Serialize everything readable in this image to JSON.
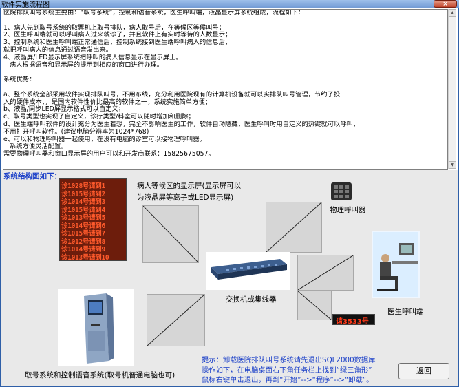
{
  "window": {
    "title": "软件实施流程图",
    "close_glyph": "×"
  },
  "text_panel": {
    "lines": [
      "医院排队叫号系统主要由：“取号系统”，控制和语音系统，医生呼叫端，液晶显示屏系统组成，流程如下：",
      "",
      "1、病人先到取号系统的取票机上取号排队，病人取号后，在等候区等候叫号；",
      "2、医生呼叫端就可以呼叫病人过来就诊了，并且软件上有实时等待的人数显示；",
      "3、控制系统和医生呼叫端正常通信后，控制系统接到医生端呼叫病人的信息后，",
      "就把呼叫病人的信息通过语音发出来。",
      "4、液晶屏/LED显示屏系统把呼叫的病人信息显示在显示屏上。",
      "   病人根据语音和显示屏的提示到相应的窗口进行办理。",
      "",
      "系统优势：",
      "",
      "a、整个系统全部采用软件实现排队叫号，不用布线，充分利用医院现有的计算机设备就可以实排队叫号管理，节约了投",
      "入的硬件成本，，是国内软件性价比最高的软件之一，系统实施简单方便；",
      "b、液晶/同步LED屏显示格式可以自定义；",
      "c、取号类型也实现了自定义，诊疗类型/科室可以随时增加和删除；",
      "d、医生端呼叫软件的设计充分为医生着想，完全不影响医生的工作，软件自动隐藏，医生呼叫时用自定义的热键就可以呼叫，",
      "不用打开呼叫软件。(建议电脑分辨率为1024*768)",
      "e、可以和物理呼叫器一起使用，在没有电脑的诊室可以接物理呼叫器。",
      "   系统方便灵活配置。",
      "需要物理呼叫器和窗口显示屏的用户可以和开发商联系：15825675057。"
    ]
  },
  "diagram": {
    "heading": "系统结构图如下：",
    "display_label_line1": "病人等候区的显示屏(显示屏可以",
    "display_label_line2": "为液晶屏等离子或LED显示屏)",
    "physical_caller_label": "物理呼叫器",
    "switch_label": "交换机或集线器",
    "doctor_label": "医生呼叫端",
    "kiosk_label": "取号系统和控制语音系统(取号机普通电脑也可)",
    "led_rows": [
      "诊1028号请到1",
      "诊1015号请到2",
      "诊1014号请到3",
      "诊1015号请到4",
      "诊1013号请到5",
      "诊1014号请到6",
      "诊1015号请到7",
      "诊1012号请到8",
      "诊1014号请到9",
      "诊1013号请到10"
    ],
    "small_led_text": "请3533号"
  },
  "hint": {
    "line1": "提示：卸载医院排队叫号系统请先退出SQL2000数据库",
    "line2": "操作如下，在电脑桌面右下角任务栏上找到“绿三角形”",
    "line3": "鼠标右键单击退出，再到“开始”-->“程序”-->“卸载”。"
  },
  "buttons": {
    "return_label": "返回"
  },
  "colors": {
    "background_blue": "#2f5fa8",
    "hint_text": "#1a3fc8",
    "heading": "#1a3fc8",
    "led_text": "#ff5a2c"
  }
}
